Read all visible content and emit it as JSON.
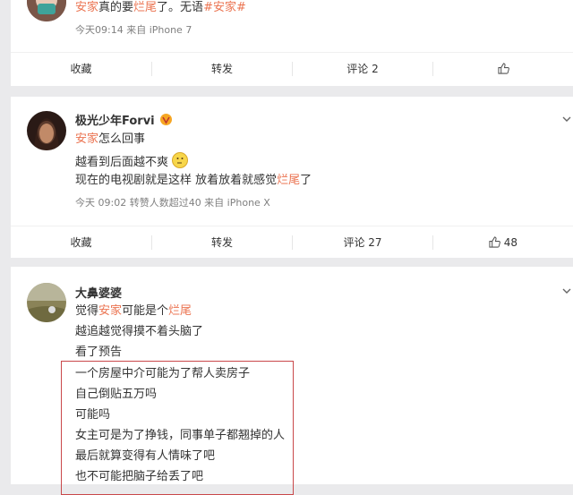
{
  "post1": {
    "text": {
      "p1": "安家",
      "p2": "真的要",
      "p3": "烂尾",
      "p4": "了。无语",
      "p5": "#安家#"
    },
    "meta": "今天09:14  来自 iPhone 7",
    "actions": {
      "fav": "收藏",
      "repost": "转发",
      "comment": "评论 2",
      "like": ""
    }
  },
  "post2": {
    "username": "极光少年Forvi",
    "line1": {
      "a": "安家",
      "b": "怎么回事"
    },
    "line2": "越看到后面越不爽",
    "line3": {
      "a": "现在的电视剧就是这样 放着放着就感觉",
      "b": "烂尾",
      "c": "了"
    },
    "meta": "今天 09:02  转赞人数超过40  来自 iPhone X",
    "actions": {
      "fav": "收藏",
      "repost": "转发",
      "comment": "评论 27",
      "like": "48"
    }
  },
  "post3": {
    "username": "大鼻婆婆",
    "line1": {
      "a": "觉得",
      "b": "安家",
      "c": "可能是个",
      "d": "烂尾"
    },
    "line2": "越追越觉得摸不着头脑了",
    "line3": "看了预告",
    "boxed": [
      "一个房屋中介可能为了帮人卖房子",
      "自己倒贴五万吗",
      "可能吗",
      "女主可是为了挣钱，同事单子都翘掉的人",
      "最后就算变得有人情味了吧",
      "也不可能把脑子给丢了吧"
    ]
  },
  "colors": {
    "highlight": "#eb7350",
    "box": "#c9484a",
    "meta": "#808080",
    "background": "#eaeaec"
  }
}
